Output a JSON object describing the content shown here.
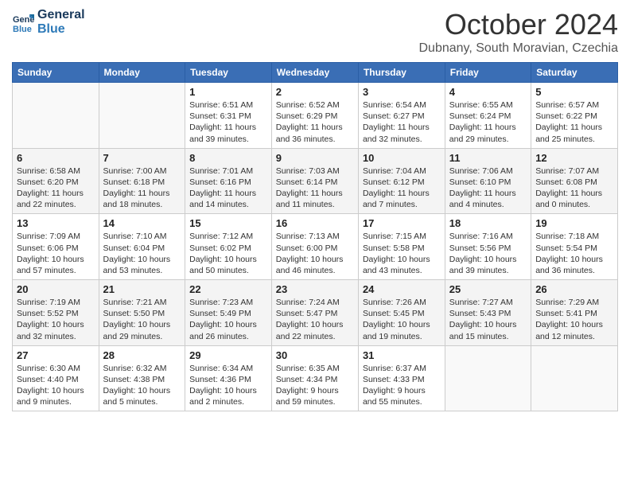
{
  "header": {
    "logo_line1": "General",
    "logo_line2": "Blue",
    "month": "October 2024",
    "location": "Dubnany, South Moravian, Czechia"
  },
  "days_of_week": [
    "Sunday",
    "Monday",
    "Tuesday",
    "Wednesday",
    "Thursday",
    "Friday",
    "Saturday"
  ],
  "weeks": [
    [
      {
        "day": "",
        "info": ""
      },
      {
        "day": "",
        "info": ""
      },
      {
        "day": "1",
        "info": "Sunrise: 6:51 AM\nSunset: 6:31 PM\nDaylight: 11 hours and 39 minutes."
      },
      {
        "day": "2",
        "info": "Sunrise: 6:52 AM\nSunset: 6:29 PM\nDaylight: 11 hours and 36 minutes."
      },
      {
        "day": "3",
        "info": "Sunrise: 6:54 AM\nSunset: 6:27 PM\nDaylight: 11 hours and 32 minutes."
      },
      {
        "day": "4",
        "info": "Sunrise: 6:55 AM\nSunset: 6:24 PM\nDaylight: 11 hours and 29 minutes."
      },
      {
        "day": "5",
        "info": "Sunrise: 6:57 AM\nSunset: 6:22 PM\nDaylight: 11 hours and 25 minutes."
      }
    ],
    [
      {
        "day": "6",
        "info": "Sunrise: 6:58 AM\nSunset: 6:20 PM\nDaylight: 11 hours and 22 minutes."
      },
      {
        "day": "7",
        "info": "Sunrise: 7:00 AM\nSunset: 6:18 PM\nDaylight: 11 hours and 18 minutes."
      },
      {
        "day": "8",
        "info": "Sunrise: 7:01 AM\nSunset: 6:16 PM\nDaylight: 11 hours and 14 minutes."
      },
      {
        "day": "9",
        "info": "Sunrise: 7:03 AM\nSunset: 6:14 PM\nDaylight: 11 hours and 11 minutes."
      },
      {
        "day": "10",
        "info": "Sunrise: 7:04 AM\nSunset: 6:12 PM\nDaylight: 11 hours and 7 minutes."
      },
      {
        "day": "11",
        "info": "Sunrise: 7:06 AM\nSunset: 6:10 PM\nDaylight: 11 hours and 4 minutes."
      },
      {
        "day": "12",
        "info": "Sunrise: 7:07 AM\nSunset: 6:08 PM\nDaylight: 11 hours and 0 minutes."
      }
    ],
    [
      {
        "day": "13",
        "info": "Sunrise: 7:09 AM\nSunset: 6:06 PM\nDaylight: 10 hours and 57 minutes."
      },
      {
        "day": "14",
        "info": "Sunrise: 7:10 AM\nSunset: 6:04 PM\nDaylight: 10 hours and 53 minutes."
      },
      {
        "day": "15",
        "info": "Sunrise: 7:12 AM\nSunset: 6:02 PM\nDaylight: 10 hours and 50 minutes."
      },
      {
        "day": "16",
        "info": "Sunrise: 7:13 AM\nSunset: 6:00 PM\nDaylight: 10 hours and 46 minutes."
      },
      {
        "day": "17",
        "info": "Sunrise: 7:15 AM\nSunset: 5:58 PM\nDaylight: 10 hours and 43 minutes."
      },
      {
        "day": "18",
        "info": "Sunrise: 7:16 AM\nSunset: 5:56 PM\nDaylight: 10 hours and 39 minutes."
      },
      {
        "day": "19",
        "info": "Sunrise: 7:18 AM\nSunset: 5:54 PM\nDaylight: 10 hours and 36 minutes."
      }
    ],
    [
      {
        "day": "20",
        "info": "Sunrise: 7:19 AM\nSunset: 5:52 PM\nDaylight: 10 hours and 32 minutes."
      },
      {
        "day": "21",
        "info": "Sunrise: 7:21 AM\nSunset: 5:50 PM\nDaylight: 10 hours and 29 minutes."
      },
      {
        "day": "22",
        "info": "Sunrise: 7:23 AM\nSunset: 5:49 PM\nDaylight: 10 hours and 26 minutes."
      },
      {
        "day": "23",
        "info": "Sunrise: 7:24 AM\nSunset: 5:47 PM\nDaylight: 10 hours and 22 minutes."
      },
      {
        "day": "24",
        "info": "Sunrise: 7:26 AM\nSunset: 5:45 PM\nDaylight: 10 hours and 19 minutes."
      },
      {
        "day": "25",
        "info": "Sunrise: 7:27 AM\nSunset: 5:43 PM\nDaylight: 10 hours and 15 minutes."
      },
      {
        "day": "26",
        "info": "Sunrise: 7:29 AM\nSunset: 5:41 PM\nDaylight: 10 hours and 12 minutes."
      }
    ],
    [
      {
        "day": "27",
        "info": "Sunrise: 6:30 AM\nSunset: 4:40 PM\nDaylight: 10 hours and 9 minutes."
      },
      {
        "day": "28",
        "info": "Sunrise: 6:32 AM\nSunset: 4:38 PM\nDaylight: 10 hours and 5 minutes."
      },
      {
        "day": "29",
        "info": "Sunrise: 6:34 AM\nSunset: 4:36 PM\nDaylight: 10 hours and 2 minutes."
      },
      {
        "day": "30",
        "info": "Sunrise: 6:35 AM\nSunset: 4:34 PM\nDaylight: 9 hours and 59 minutes."
      },
      {
        "day": "31",
        "info": "Sunrise: 6:37 AM\nSunset: 4:33 PM\nDaylight: 9 hours and 55 minutes."
      },
      {
        "day": "",
        "info": ""
      },
      {
        "day": "",
        "info": ""
      }
    ]
  ]
}
